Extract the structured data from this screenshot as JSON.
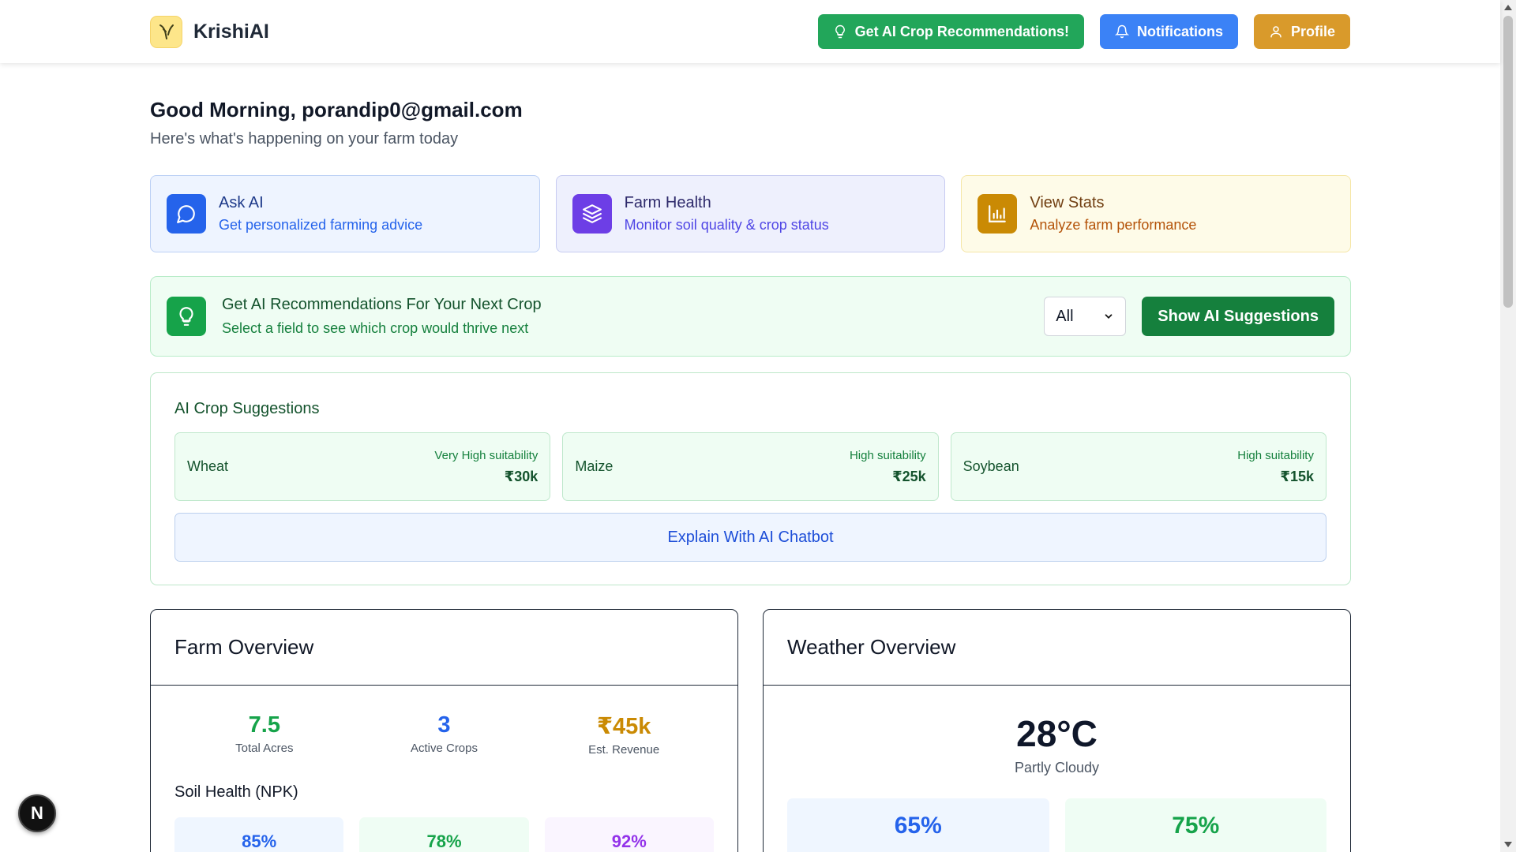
{
  "brand": {
    "name": "KrishiAI"
  },
  "nav": {
    "crop_recs_label": "Get AI Crop Recommendations!",
    "notifications_label": "Notifications",
    "profile_label": "Profile"
  },
  "greeting": {
    "title": "Good Morning, porandip0@gmail.com",
    "subtitle": "Here's what's happening on your farm today"
  },
  "quick_actions": [
    {
      "title": "Ask AI",
      "subtitle": "Get personalized farming advice",
      "icon": "chat-bubble-icon"
    },
    {
      "title": "Farm Health",
      "subtitle": "Monitor soil quality & crop status",
      "icon": "layers-icon"
    },
    {
      "title": "View Stats",
      "subtitle": "Analyze farm performance",
      "icon": "bar-chart-icon"
    }
  ],
  "recommendation": {
    "title": "Get AI Recommendations For Your Next Crop",
    "subtitle": "Select a field to see which crop would thrive next",
    "field_select_value": "All",
    "button_label": "Show AI Suggestions"
  },
  "suggestions": {
    "heading": "AI Crop Suggestions",
    "crops": [
      {
        "name": "Wheat",
        "suitability": "Very High suitability",
        "value": "₹30k"
      },
      {
        "name": "Maize",
        "suitability": "High suitability",
        "value": "₹25k"
      },
      {
        "name": "Soybean",
        "suitability": "High suitability",
        "value": "₹15k"
      }
    ],
    "explain_label": "Explain With AI Chatbot"
  },
  "farm_overview": {
    "title": "Farm Overview",
    "stats": [
      {
        "value": "7.5",
        "label": "Total Acres",
        "color": "#16a34a"
      },
      {
        "value": "3",
        "label": "Active Crops",
        "color": "#2563eb"
      },
      {
        "value": "₹45k",
        "label": "Est. Revenue",
        "color": "#ca8a04"
      }
    ],
    "soil_title": "Soil Health (NPK)",
    "npk": [
      "85%",
      "78%",
      "92%"
    ]
  },
  "weather": {
    "title": "Weather Overview",
    "temperature": "28°C",
    "condition": "Partly Cloudy",
    "cards": [
      "65%",
      "75%"
    ]
  },
  "badge": {
    "letter": "N"
  }
}
